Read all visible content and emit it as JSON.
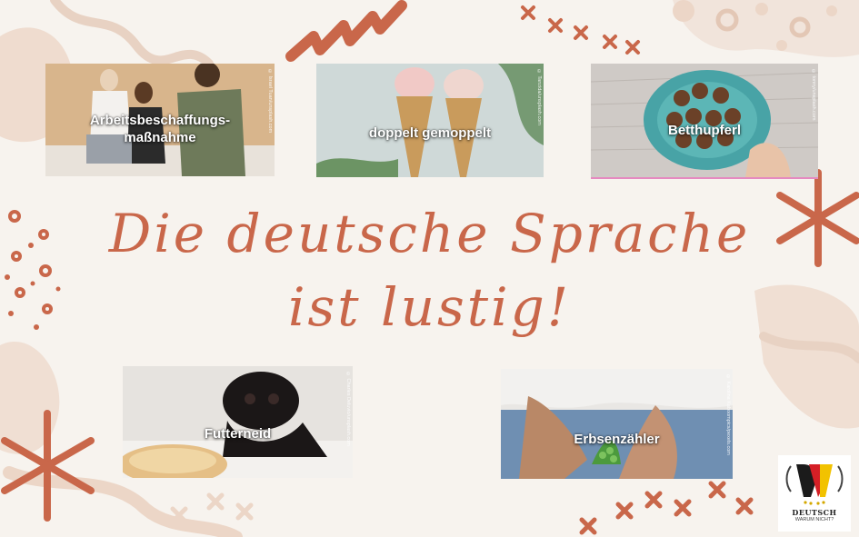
{
  "headline": {
    "line1": "Die deutsche Sprache",
    "line2": "ist lustig!"
  },
  "cards": [
    {
      "label_line1": "Arbeitsbeschaffungs-",
      "label_line2": "maßnahme",
      "credit": "© Israel Tuan/unsplash.com"
    },
    {
      "label": "doppelt gemoppelt",
      "credit": "© Tanzida/unsplash.com"
    },
    {
      "label": "Betthupferl",
      "credit": "© tonny/unsplash.com"
    },
    {
      "label": "Futterneid",
      "credit": "© Charles Deluvio/unsplash.com"
    },
    {
      "label": "Erbsenzähler",
      "credit": "© Karolina Kaboompics/pexels.com"
    }
  ],
  "logo": {
    "brand": "DEUTSCH",
    "tagline": "WARUM NICHT?"
  },
  "colors": {
    "background": "#f7f3ee",
    "accent": "#c9674a",
    "blob": "#ecd6c7"
  }
}
